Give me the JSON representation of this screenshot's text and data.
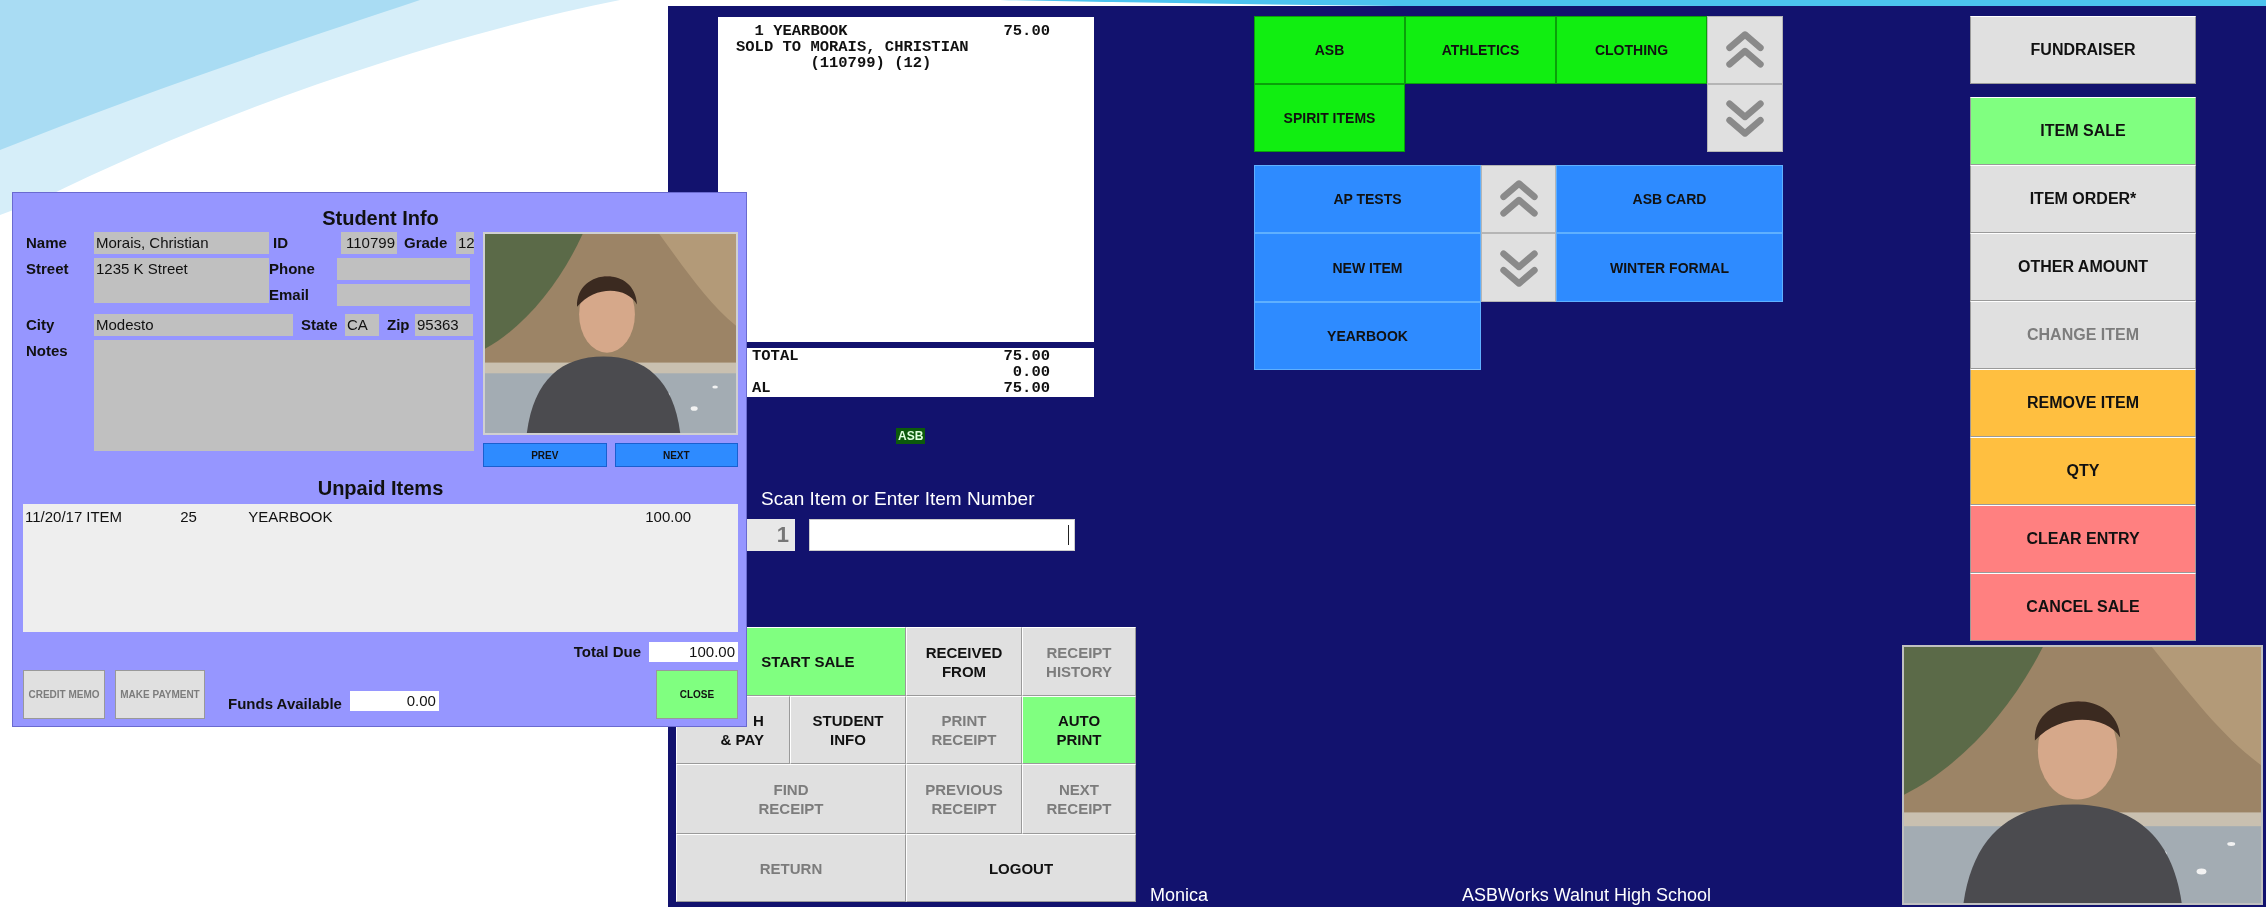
{
  "student_info": {
    "title": "Student Info",
    "name": {
      "label": "Name",
      "value": "Morais, Christian"
    },
    "id": {
      "label": "ID",
      "value": "110799"
    },
    "grade": {
      "label": "Grade",
      "value": "12"
    },
    "street": {
      "label": "Street",
      "value": "1235 K Street"
    },
    "phone": {
      "label": "Phone"
    },
    "email": {
      "label": "Email"
    },
    "city": {
      "label": "City",
      "value": "Modesto"
    },
    "state": {
      "label": "State",
      "value": "CA"
    },
    "zip": {
      "label": "Zip",
      "value": "95363"
    },
    "notes": {
      "label": "Notes"
    },
    "photo_buttons": [
      {
        "label": "PREV"
      },
      {
        "label": "NEXT"
      }
    ],
    "unpaid_title": "Unpaid Items",
    "unpaid_items": [
      {
        "date": "11/20/17",
        "type": "ITEM",
        "qty": "25",
        "description": "YEARBOOK",
        "amount": "100.00"
      }
    ],
    "total_due": {
      "label": "Total Due",
      "value": "100.00"
    },
    "action_buttons": [
      {
        "label": "CREDIT MEMO",
        "disabled": true
      },
      {
        "label": "MAKE PAYMENT",
        "disabled": true
      }
    ],
    "funds_available": {
      "label": "Funds Available",
      "value": "0.00"
    },
    "close_button": {
      "label": "CLOSE"
    }
  },
  "receipt": {
    "lines": [
      {
        "text": "  1 YEARBOOK",
        "amount": "75.00"
      },
      {
        "text": "SOLD TO MORAIS, CHRISTIAN"
      },
      {
        "text": "        (110799) (12)"
      }
    ],
    "totals": [
      {
        "label": "TOTAL",
        "amount": "75.00"
      },
      {
        "amount": "0.00"
      },
      {
        "label": "AL",
        "amount": "75.00"
      }
    ]
  },
  "sale_category_badge": "ASB",
  "scan": {
    "label": "Scan Item or Enter Item Number",
    "quantity": "1"
  },
  "categories": [
    {
      "label": "ASB"
    },
    {
      "label": "ATHLETICS"
    },
    {
      "label": "CLOTHING"
    },
    {
      "label": "SPIRIT ITEMS"
    }
  ],
  "items": [
    {
      "label": "AP TESTS"
    },
    {
      "label": "ASB CARD"
    },
    {
      "label": "NEW ITEM"
    },
    {
      "label": "WINTER FORMAL"
    },
    {
      "label": "YEARBOOK"
    }
  ],
  "mode_button": {
    "label": "FUNDRAISER"
  },
  "actions": [
    {
      "label": "ITEM SALE",
      "color": "#80ff80",
      "disabled": false
    },
    {
      "label": "ITEM ORDER*",
      "color": "#e0e0e0",
      "disabled": false
    },
    {
      "label": "OTHER AMOUNT",
      "color": "#e0e0e0",
      "disabled": false
    },
    {
      "label": "CHANGE ITEM",
      "color": "#e0e0e0",
      "disabled": true
    },
    {
      "label": "REMOVE ITEM",
      "color": "#ffbf40",
      "disabled": false
    },
    {
      "label": "QTY",
      "color": "#ffbf40",
      "disabled": false
    },
    {
      "label": "CLEAR ENTRY",
      "color": "#ff8080",
      "disabled": false
    },
    {
      "label": "CANCEL SALE",
      "color": "#ff8080",
      "disabled": false
    }
  ],
  "register_buttons": [
    {
      "lines": [
        "START SALE"
      ],
      "color": "#80ff80",
      "disabled": false,
      "wide": true,
      "cut_off": true
    },
    {
      "lines": [
        "RECEIVED",
        "FROM"
      ],
      "color": "#e0e0e0",
      "disabled": false,
      "wide": false,
      "cut_off": false
    },
    {
      "lines": [
        "RECEIPT",
        "HISTORY"
      ],
      "color": "#e0e0e0",
      "disabled": true,
      "wide": false,
      "cut_off": false
    },
    {
      "lines": [
        "H",
        "& PAY"
      ],
      "color": "#e0e0e0",
      "disabled": false,
      "wide": false,
      "cut_off": true
    },
    {
      "lines": [
        "STUDENT",
        "INFO"
      ],
      "color": "#e0e0e0",
      "disabled": false,
      "wide": false,
      "cut_off": false
    },
    {
      "lines": [
        "PRINT",
        "RECEIPT"
      ],
      "color": "#e0e0e0",
      "disabled": true,
      "wide": false,
      "cut_off": false
    },
    {
      "lines": [
        "AUTO",
        "PRINT"
      ],
      "color": "#80ff80",
      "disabled": false,
      "wide": false,
      "cut_off": false
    },
    {
      "lines": [
        "FIND",
        "RECEIPT"
      ],
      "color": "#e0e0e0",
      "disabled": true,
      "wide": true,
      "cut_off": false
    },
    {
      "lines": [
        "PREVIOUS",
        "RECEIPT"
      ],
      "color": "#e0e0e0",
      "disabled": true,
      "wide": false,
      "cut_off": false
    },
    {
      "lines": [
        "NEXT",
        "RECEIPT"
      ],
      "color": "#e0e0e0",
      "disabled": true,
      "wide": false,
      "cut_off": false
    },
    {
      "lines": [
        "RETURN"
      ],
      "color": "#e0e0e0",
      "disabled": true,
      "wide": true,
      "cut_off": false
    },
    {
      "lines": [
        "LOGOUT"
      ],
      "color": "#e0e0e0",
      "disabled": false,
      "wide": true,
      "cut_off": false
    }
  ],
  "footer": {
    "operator": "Monica",
    "school": "ASBWorks Walnut High School"
  }
}
